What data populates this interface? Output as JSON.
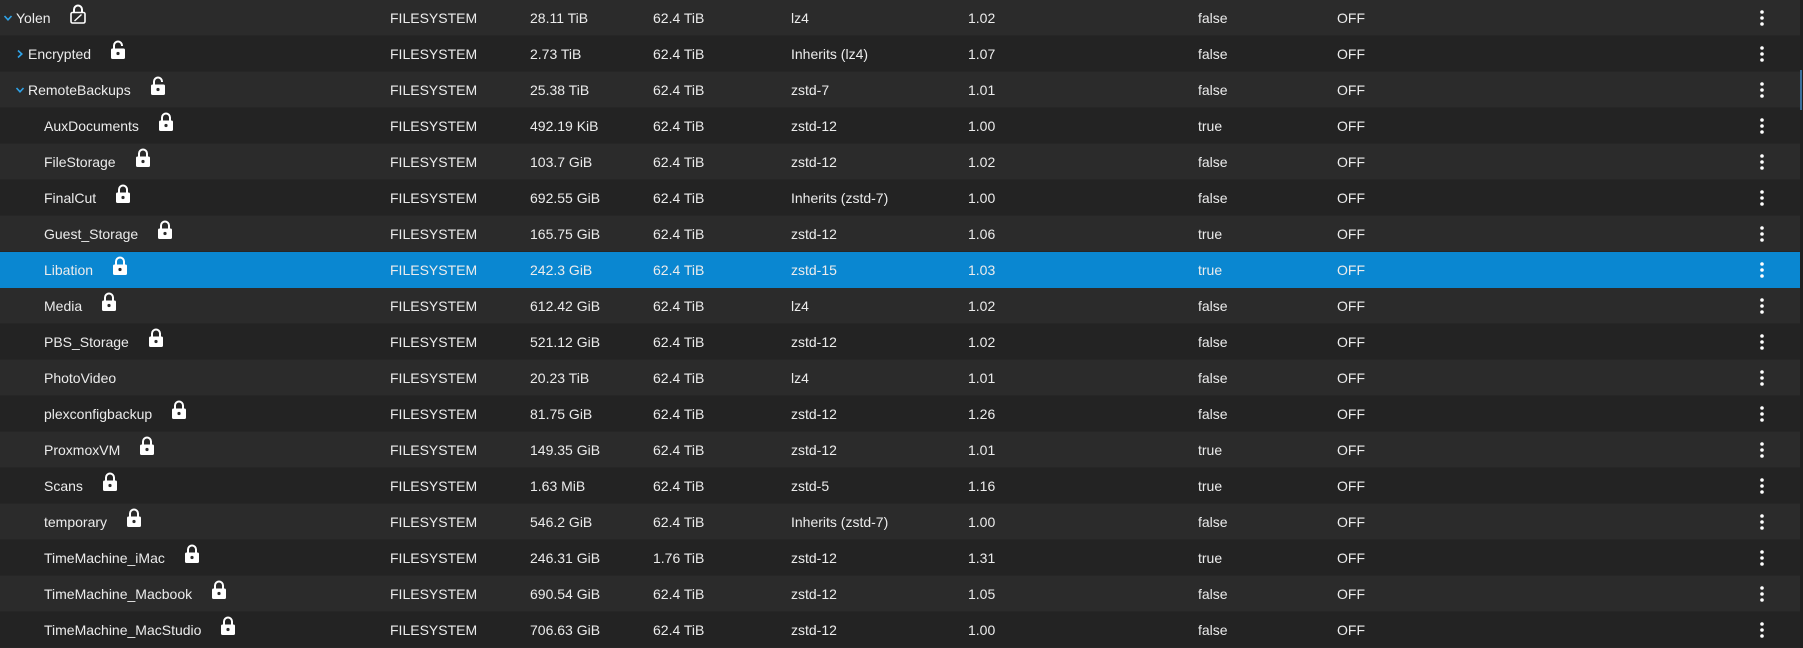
{
  "colors": {
    "row_odd": "#2b2b2b",
    "row_even": "#232323",
    "selected": "#0a87d1",
    "accent": "#2fa3e8",
    "text": "#ececec"
  },
  "icons": {
    "expand": "chevron-right-icon",
    "collapse": "chevron-down-icon",
    "locked": "lock-icon",
    "unlocked": "unlock-icon",
    "menu": "more-vertical-icon"
  },
  "rows": [
    {
      "name": "Yolen",
      "level": 0,
      "toggle": "collapse",
      "lock": "encrypted-root",
      "type": "FILESYSTEM",
      "used": "28.11 TiB",
      "available": "62.4 TiB",
      "compression": "lz4",
      "ratio": "1.02",
      "readonly": "false",
      "dedup": "OFF",
      "selected": false
    },
    {
      "name": "Encrypted",
      "level": 1,
      "toggle": "expand",
      "lock": "unlocked",
      "type": "FILESYSTEM",
      "used": "2.73 TiB",
      "available": "62.4 TiB",
      "compression": "Inherits (lz4)",
      "ratio": "1.07",
      "readonly": "false",
      "dedup": "OFF",
      "selected": false
    },
    {
      "name": "RemoteBackups",
      "level": 1,
      "toggle": "collapse",
      "lock": "unlocked",
      "type": "FILESYSTEM",
      "used": "25.38 TiB",
      "available": "62.4 TiB",
      "compression": "zstd-7",
      "ratio": "1.01",
      "readonly": "false",
      "dedup": "OFF",
      "selected": false
    },
    {
      "name": "AuxDocuments",
      "level": 2,
      "toggle": "",
      "lock": "locked",
      "type": "FILESYSTEM",
      "used": "492.19 KiB",
      "available": "62.4 TiB",
      "compression": "zstd-12",
      "ratio": "1.00",
      "readonly": "true",
      "dedup": "OFF",
      "selected": false
    },
    {
      "name": "FileStorage",
      "level": 2,
      "toggle": "",
      "lock": "locked",
      "type": "FILESYSTEM",
      "used": "103.7 GiB",
      "available": "62.4 TiB",
      "compression": "zstd-12",
      "ratio": "1.02",
      "readonly": "false",
      "dedup": "OFF",
      "selected": false
    },
    {
      "name": "FinalCut",
      "level": 2,
      "toggle": "",
      "lock": "locked",
      "type": "FILESYSTEM",
      "used": "692.55 GiB",
      "available": "62.4 TiB",
      "compression": "Inherits (zstd-7)",
      "ratio": "1.00",
      "readonly": "false",
      "dedup": "OFF",
      "selected": false
    },
    {
      "name": "Guest_Storage",
      "level": 2,
      "toggle": "",
      "lock": "locked",
      "type": "FILESYSTEM",
      "used": "165.75 GiB",
      "available": "62.4 TiB",
      "compression": "zstd-12",
      "ratio": "1.06",
      "readonly": "true",
      "dedup": "OFF",
      "selected": false
    },
    {
      "name": "Libation",
      "level": 2,
      "toggle": "",
      "lock": "locked",
      "type": "FILESYSTEM",
      "used": "242.3 GiB",
      "available": "62.4 TiB",
      "compression": "zstd-15",
      "ratio": "1.03",
      "readonly": "true",
      "dedup": "OFF",
      "selected": true
    },
    {
      "name": "Media",
      "level": 2,
      "toggle": "",
      "lock": "locked",
      "type": "FILESYSTEM",
      "used": "612.42 GiB",
      "available": "62.4 TiB",
      "compression": "lz4",
      "ratio": "1.02",
      "readonly": "false",
      "dedup": "OFF",
      "selected": false
    },
    {
      "name": "PBS_Storage",
      "level": 2,
      "toggle": "",
      "lock": "locked",
      "type": "FILESYSTEM",
      "used": "521.12 GiB",
      "available": "62.4 TiB",
      "compression": "zstd-12",
      "ratio": "1.02",
      "readonly": "false",
      "dedup": "OFF",
      "selected": false
    },
    {
      "name": "PhotoVideo",
      "level": 2,
      "toggle": "",
      "lock": "",
      "type": "FILESYSTEM",
      "used": "20.23 TiB",
      "available": "62.4 TiB",
      "compression": "lz4",
      "ratio": "1.01",
      "readonly": "false",
      "dedup": "OFF",
      "selected": false
    },
    {
      "name": "plexconfigbackup",
      "level": 2,
      "toggle": "",
      "lock": "locked",
      "type": "FILESYSTEM",
      "used": "81.75 GiB",
      "available": "62.4 TiB",
      "compression": "zstd-12",
      "ratio": "1.26",
      "readonly": "false",
      "dedup": "OFF",
      "selected": false
    },
    {
      "name": "ProxmoxVM",
      "level": 2,
      "toggle": "",
      "lock": "locked",
      "type": "FILESYSTEM",
      "used": "149.35 GiB",
      "available": "62.4 TiB",
      "compression": "zstd-12",
      "ratio": "1.01",
      "readonly": "true",
      "dedup": "OFF",
      "selected": false
    },
    {
      "name": "Scans",
      "level": 2,
      "toggle": "",
      "lock": "locked",
      "type": "FILESYSTEM",
      "used": "1.63 MiB",
      "available": "62.4 TiB",
      "compression": "zstd-5",
      "ratio": "1.16",
      "readonly": "true",
      "dedup": "OFF",
      "selected": false
    },
    {
      "name": "temporary",
      "level": 2,
      "toggle": "",
      "lock": "locked",
      "type": "FILESYSTEM",
      "used": "546.2 GiB",
      "available": "62.4 TiB",
      "compression": "Inherits (zstd-7)",
      "ratio": "1.00",
      "readonly": "false",
      "dedup": "OFF",
      "selected": false
    },
    {
      "name": "TimeMachine_iMac",
      "level": 2,
      "toggle": "",
      "lock": "locked",
      "type": "FILESYSTEM",
      "used": "246.31 GiB",
      "available": "1.76 TiB",
      "compression": "zstd-12",
      "ratio": "1.31",
      "readonly": "true",
      "dedup": "OFF",
      "selected": false
    },
    {
      "name": "TimeMachine_Macbook",
      "level": 2,
      "toggle": "",
      "lock": "locked",
      "type": "FILESYSTEM",
      "used": "690.54 GiB",
      "available": "62.4 TiB",
      "compression": "zstd-12",
      "ratio": "1.05",
      "readonly": "false",
      "dedup": "OFF",
      "selected": false
    },
    {
      "name": "TimeMachine_MacStudio",
      "level": 2,
      "toggle": "",
      "lock": "locked",
      "type": "FILESYSTEM",
      "used": "706.63 GiB",
      "available": "62.4 TiB",
      "compression": "zstd-12",
      "ratio": "1.00",
      "readonly": "false",
      "dedup": "OFF",
      "selected": false
    }
  ]
}
